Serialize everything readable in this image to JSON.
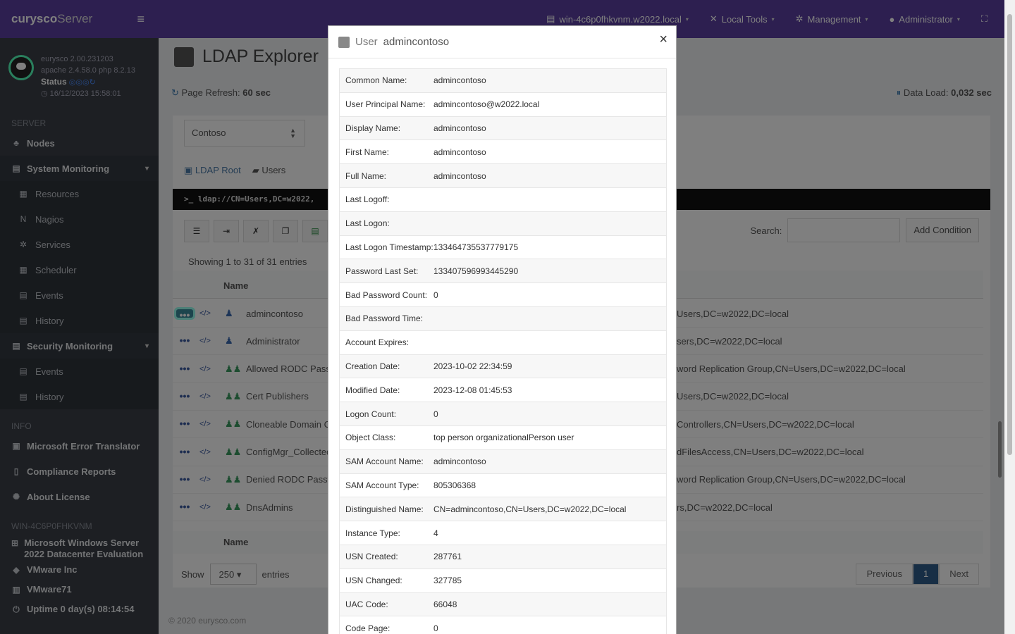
{
  "brand": {
    "a": "curysco",
    "b": "Server"
  },
  "profile": {
    "version": "eurysco 2.00.231203",
    "apache": "apache 2.4.58.0 php 8.2.13",
    "status": "Status",
    "time": "16/12/2023 15:58:01"
  },
  "topbar": {
    "host": "win-4c6p0fhkvnm.w2022.local",
    "tools": "Local Tools",
    "mgmt": "Management",
    "user": "Administrator"
  },
  "sidebar": {
    "server_h": "SERVER",
    "nodes": "Nodes",
    "sysmon": "System Monitoring",
    "sys_items": [
      "Resources",
      "Nagios",
      "Services",
      "Scheduler",
      "Events",
      "History"
    ],
    "secmon": "Security Monitoring",
    "sec_items": [
      "Events",
      "History"
    ],
    "info_h": "INFO",
    "met": "Microsoft Error Translator",
    "comp": "Compliance Reports",
    "lic": "About License",
    "host_h": "WIN-4C6P0FHKVNM",
    "os": "Microsoft  Windows  Server 2022  Datacenter  Evaluation",
    "vendor": "VMware Inc",
    "model": "VMware71",
    "uptime": "Uptime 0 day(s) 08:14:54"
  },
  "main": {
    "title": "LDAP Explorer",
    "refresh_label": "Page Refresh:",
    "refresh_val": "60 sec",
    "load_label": "Data Load:",
    "load_val": "0,032 sec",
    "domain": "Contoso",
    "crumb_root": "LDAP Root",
    "crumb_users": "Users",
    "ldap_path": ">_  ldap://CN=Users,DC=w2022,",
    "search_label": "Search:",
    "add_condition": "Add Condition",
    "showing": "Showing 1 to 31 of 31 entries",
    "col_name": "Name",
    "rows": [
      {
        "name": "admincontoso",
        "dn": "Users,DC=w2022,DC=local"
      },
      {
        "name": "Administrator",
        "dn": "sers,DC=w2022,DC=local"
      },
      {
        "name": "Allowed RODC Passw",
        "dn": "word Replication Group,CN=Users,DC=w2022,DC=local"
      },
      {
        "name": "Cert Publishers",
        "dn": "Users,DC=w2022,DC=local"
      },
      {
        "name": "Cloneable Domain Co",
        "dn": "Controllers,CN=Users,DC=w2022,DC=local"
      },
      {
        "name": "ConfigMgr_CollectedF",
        "dn": "dFilesAccess,CN=Users,DC=w2022,DC=local"
      },
      {
        "name": "Denied RODC Passwo",
        "dn": "word Replication Group,CN=Users,DC=w2022,DC=local"
      },
      {
        "name": "DnsAdmins",
        "dn": "rs,DC=w2022,DC=local"
      }
    ],
    "show": "Show",
    "entries_num": "250",
    "entries": "entries",
    "prev": "Previous",
    "page": "1",
    "next": "Next",
    "copyright": "© 2020   eurysco.com"
  },
  "modal": {
    "title_prefix": "User",
    "title_name": "admincontoso",
    "close": "×",
    "fields": [
      {
        "k": "Common Name:",
        "v": "admincontoso"
      },
      {
        "k": "User Principal Name:",
        "v": "admincontoso@w2022.local"
      },
      {
        "k": "Display Name:",
        "v": "admincontoso"
      },
      {
        "k": "First Name:",
        "v": "admincontoso"
      },
      {
        "k": "Full Name:",
        "v": "admincontoso"
      },
      {
        "k": "Last Logoff:",
        "v": ""
      },
      {
        "k": "Last Logon:",
        "v": ""
      },
      {
        "k": "Last Logon Timestamp:",
        "v": "133464735537779175"
      },
      {
        "k": "Password Last Set:",
        "v": "133407596993445290"
      },
      {
        "k": "Bad Password Count:",
        "v": "0"
      },
      {
        "k": "Bad Password Time:",
        "v": ""
      },
      {
        "k": "Account Expires:",
        "v": ""
      },
      {
        "k": "Creation Date:",
        "v": "2023-10-02 22:34:59"
      },
      {
        "k": "Modified Date:",
        "v": "2023-12-08 01:45:53"
      },
      {
        "k": "Logon Count:",
        "v": "0"
      },
      {
        "k": "Object Class:",
        "v": "top person organizationalPerson user"
      },
      {
        "k": "SAM Account Name:",
        "v": "admincontoso"
      },
      {
        "k": "SAM Account Type:",
        "v": "805306368"
      },
      {
        "k": "Distinguished Name:",
        "v": "CN=admincontoso,CN=Users,DC=w2022,DC=local"
      },
      {
        "k": "Instance Type:",
        "v": "4"
      },
      {
        "k": "USN Created:",
        "v": "287761"
      },
      {
        "k": "USN Changed:",
        "v": "327785"
      },
      {
        "k": "UAC Code:",
        "v": "66048"
      },
      {
        "k": "Code Page:",
        "v": "0"
      }
    ]
  }
}
